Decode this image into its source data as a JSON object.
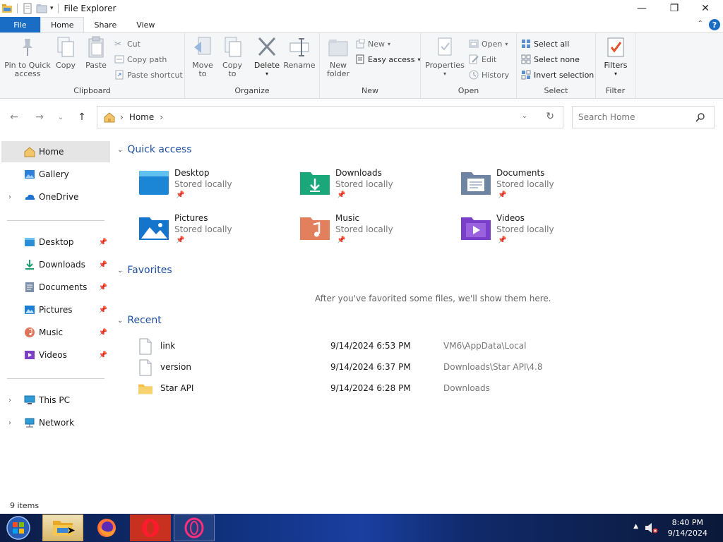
{
  "window": {
    "title": "File Explorer",
    "minimize_glyph": "—",
    "maximize_glyph": "❐",
    "close_glyph": "✕"
  },
  "tabs": {
    "file": "File",
    "home": "Home",
    "share": "Share",
    "view": "View",
    "help": "?"
  },
  "ribbon": {
    "clipboard": {
      "label": "Clipboard",
      "pin_to_quick_access": "Pin to Quick access",
      "pin_line1": "Pin to Quick",
      "pin_line2": "access",
      "copy": "Copy",
      "paste": "Paste",
      "cut": "Cut",
      "copy_path": "Copy path",
      "paste_shortcut": "Paste shortcut"
    },
    "organize": {
      "label": "Organize",
      "move_to_1": "Move",
      "move_to_2": "to",
      "copy_to_1": "Copy",
      "copy_to_2": "to",
      "delete": "Delete",
      "rename": "Rename"
    },
    "new": {
      "label": "New",
      "new_folder_1": "New",
      "new_folder_2": "folder",
      "new_item": "New",
      "easy_access": "Easy access"
    },
    "open": {
      "label": "Open",
      "properties": "Properties",
      "open": "Open",
      "edit": "Edit",
      "history": "History"
    },
    "select": {
      "label": "Select",
      "select_all": "Select all",
      "select_none": "Select none",
      "invert_selection": "Invert selection"
    },
    "filter": {
      "label": "Filter",
      "filters": "Filters"
    }
  },
  "address": {
    "crumb": "Home",
    "separator": "›"
  },
  "search": {
    "placeholder": "Search Home"
  },
  "sidebar": {
    "items": [
      {
        "label": "Home"
      },
      {
        "label": "Gallery"
      },
      {
        "label": "OneDrive"
      },
      {
        "label": "Desktop"
      },
      {
        "label": "Downloads"
      },
      {
        "label": "Documents"
      },
      {
        "label": "Pictures"
      },
      {
        "label": "Music"
      },
      {
        "label": "Videos"
      },
      {
        "label": "This PC"
      },
      {
        "label": "Network"
      }
    ]
  },
  "sections": {
    "quick_access": "Quick access",
    "favorites": "Favorites",
    "recent": "Recent",
    "favorites_empty": "After you've favorited some files, we'll show them here."
  },
  "quick_access": [
    {
      "name": "Desktop",
      "sub": "Stored locally"
    },
    {
      "name": "Downloads",
      "sub": "Stored locally"
    },
    {
      "name": "Documents",
      "sub": "Stored locally"
    },
    {
      "name": "Pictures",
      "sub": "Stored locally"
    },
    {
      "name": "Music",
      "sub": "Stored locally"
    },
    {
      "name": "Videos",
      "sub": "Stored locally"
    }
  ],
  "recent": [
    {
      "name": "link",
      "date": "9/14/2024 6:53 PM",
      "location": "VM6\\AppData\\Local"
    },
    {
      "name": "version",
      "date": "9/14/2024 6:37 PM",
      "location": "Downloads\\Star API\\4.8"
    },
    {
      "name": "Star API",
      "date": "9/14/2024 6:28 PM",
      "location": "Downloads"
    }
  ],
  "status": {
    "items": "9 items"
  },
  "taskbar": {
    "time": "8:40 PM",
    "date": "9/14/2024"
  },
  "colors": {
    "accent": "#1a6dc4",
    "link_heading": "#1f4fa0"
  }
}
